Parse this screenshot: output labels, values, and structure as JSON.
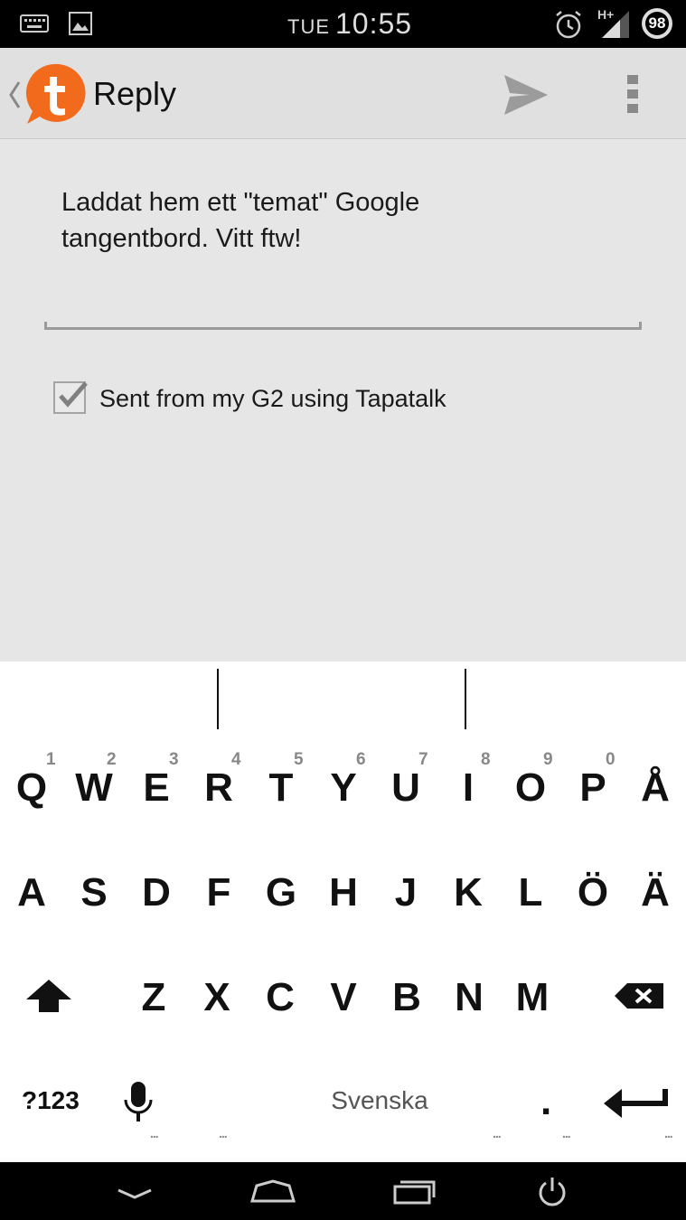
{
  "status_bar": {
    "day": "TUE",
    "time": "10:55",
    "battery": "98",
    "network": "H+",
    "icons": [
      "keyboard-icon",
      "image-icon",
      "alarm-icon",
      "signal-icon",
      "battery-icon"
    ]
  },
  "action_bar": {
    "title": "Reply",
    "icons": [
      "back-chevron-icon",
      "tapatalk-logo-icon",
      "send-icon",
      "overflow-menu-icon"
    ]
  },
  "editor": {
    "text": "Laddat hem ett \"temat\" Google tangentbord. Vitt ftw!"
  },
  "signature": {
    "label": "Sent from my G2 using Tapatalk",
    "checked": true
  },
  "keyboard": {
    "row1": [
      {
        "key": "Q",
        "hint": "1"
      },
      {
        "key": "W",
        "hint": "2"
      },
      {
        "key": "E",
        "hint": "3"
      },
      {
        "key": "R",
        "hint": "4"
      },
      {
        "key": "T",
        "hint": "5"
      },
      {
        "key": "Y",
        "hint": "6"
      },
      {
        "key": "U",
        "hint": "7"
      },
      {
        "key": "I",
        "hint": "8"
      },
      {
        "key": "O",
        "hint": "9"
      },
      {
        "key": "P",
        "hint": "0"
      },
      {
        "key": "Å",
        "hint": ""
      }
    ],
    "row2": [
      "A",
      "S",
      "D",
      "F",
      "G",
      "H",
      "J",
      "K",
      "L",
      "Ö",
      "Ä"
    ],
    "row3": [
      "Z",
      "X",
      "C",
      "V",
      "B",
      "N",
      "M"
    ],
    "symbols_label": "?123",
    "space_label": "Svenska",
    "period_label": ".",
    "more_dots": "..."
  },
  "nav_bar": {
    "icons": [
      "hide-keyboard-icon",
      "home-icon",
      "recents-icon",
      "power-icon"
    ]
  }
}
